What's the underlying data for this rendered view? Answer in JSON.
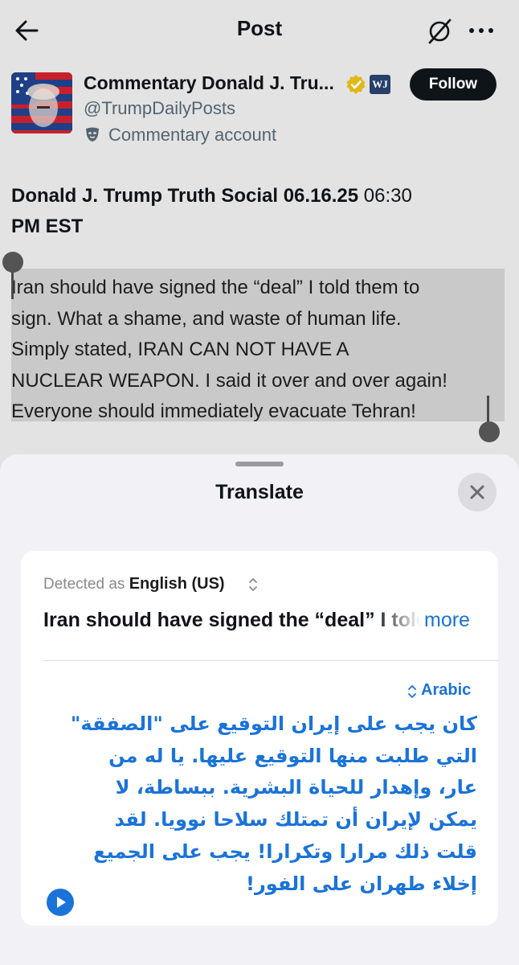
{
  "header": {
    "title": "Post",
    "back_icon": "arrow-left-icon",
    "grok_icon": "grok-icon",
    "more_icon": "more-horizontal-icon"
  },
  "author": {
    "name": "Commentary Donald J. Tru...",
    "handle": "@TrumpDailyPosts",
    "badge_text": "WJ",
    "account_type": "Commentary account",
    "follow_label": "Follow",
    "verified_color": "#e2b719"
  },
  "post": {
    "heading_bold": "Donald J. Trump Truth Social 06.16.25",
    "heading_time": " 06:30",
    "heading_tz": "PM EST",
    "body": "Iran should have signed the “deal” I told them to sign. What a shame, and waste of human life. Simply stated, IRAN CAN NOT HAVE A NUCLEAR WEAPON. I said it over and over again! Everyone should immediately evacuate Tehran!",
    "body_lines": [
      "Iran should have signed the “deal” I told them to",
      "sign. What a shame, and waste of human life.",
      "Simply stated, IRAN CAN NOT HAVE A",
      "NUCLEAR WEAPON. I said it over and over again!",
      "Everyone should immediately evacuate Tehran!"
    ]
  },
  "translate": {
    "title": "Translate",
    "detected_prefix": "Detected as",
    "detected_language": "English (US)",
    "source_preview": "Iran should have signed the “deal” I told them to sign",
    "more_label": "more",
    "target_language": "Arabic",
    "translation": "كان يجب على إيران التوقيع على \"الصفقة\" التي طلبت منها التوقيع عليها. يا له من عار، وإهدار للحياة البشرية. ببساطة، لا يمكن لإيران أن تمتلك سلاحا نوويا. لقد قلت ذلك مرارا وتكرارا! يجب على الجميع إخلاء طهران على الفور!",
    "accent_color": "#1a73d9"
  }
}
